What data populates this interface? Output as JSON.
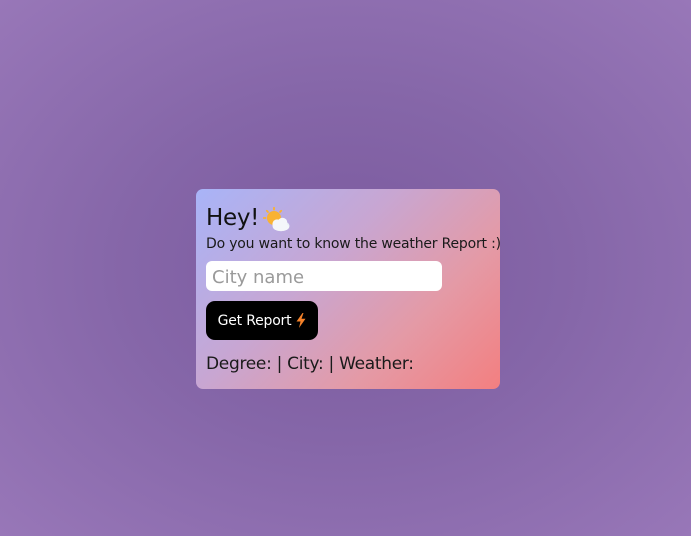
{
  "card": {
    "title": "Hey!",
    "title_icon": "sun-behind-cloud-icon",
    "subtitle": "Do you want to know the weather Report :)"
  },
  "search": {
    "placeholder": "City name",
    "value": ""
  },
  "button": {
    "label": "Get Report",
    "icon": "lightning-bolt-icon"
  },
  "result": {
    "text": "Degree: | City: | Weather:"
  },
  "colors": {
    "background": "#8566a8",
    "card_gradient_start": "#a8b4f8",
    "card_gradient_end": "#f37f80",
    "button_bg": "#000000",
    "bolt": "#f5822a"
  }
}
